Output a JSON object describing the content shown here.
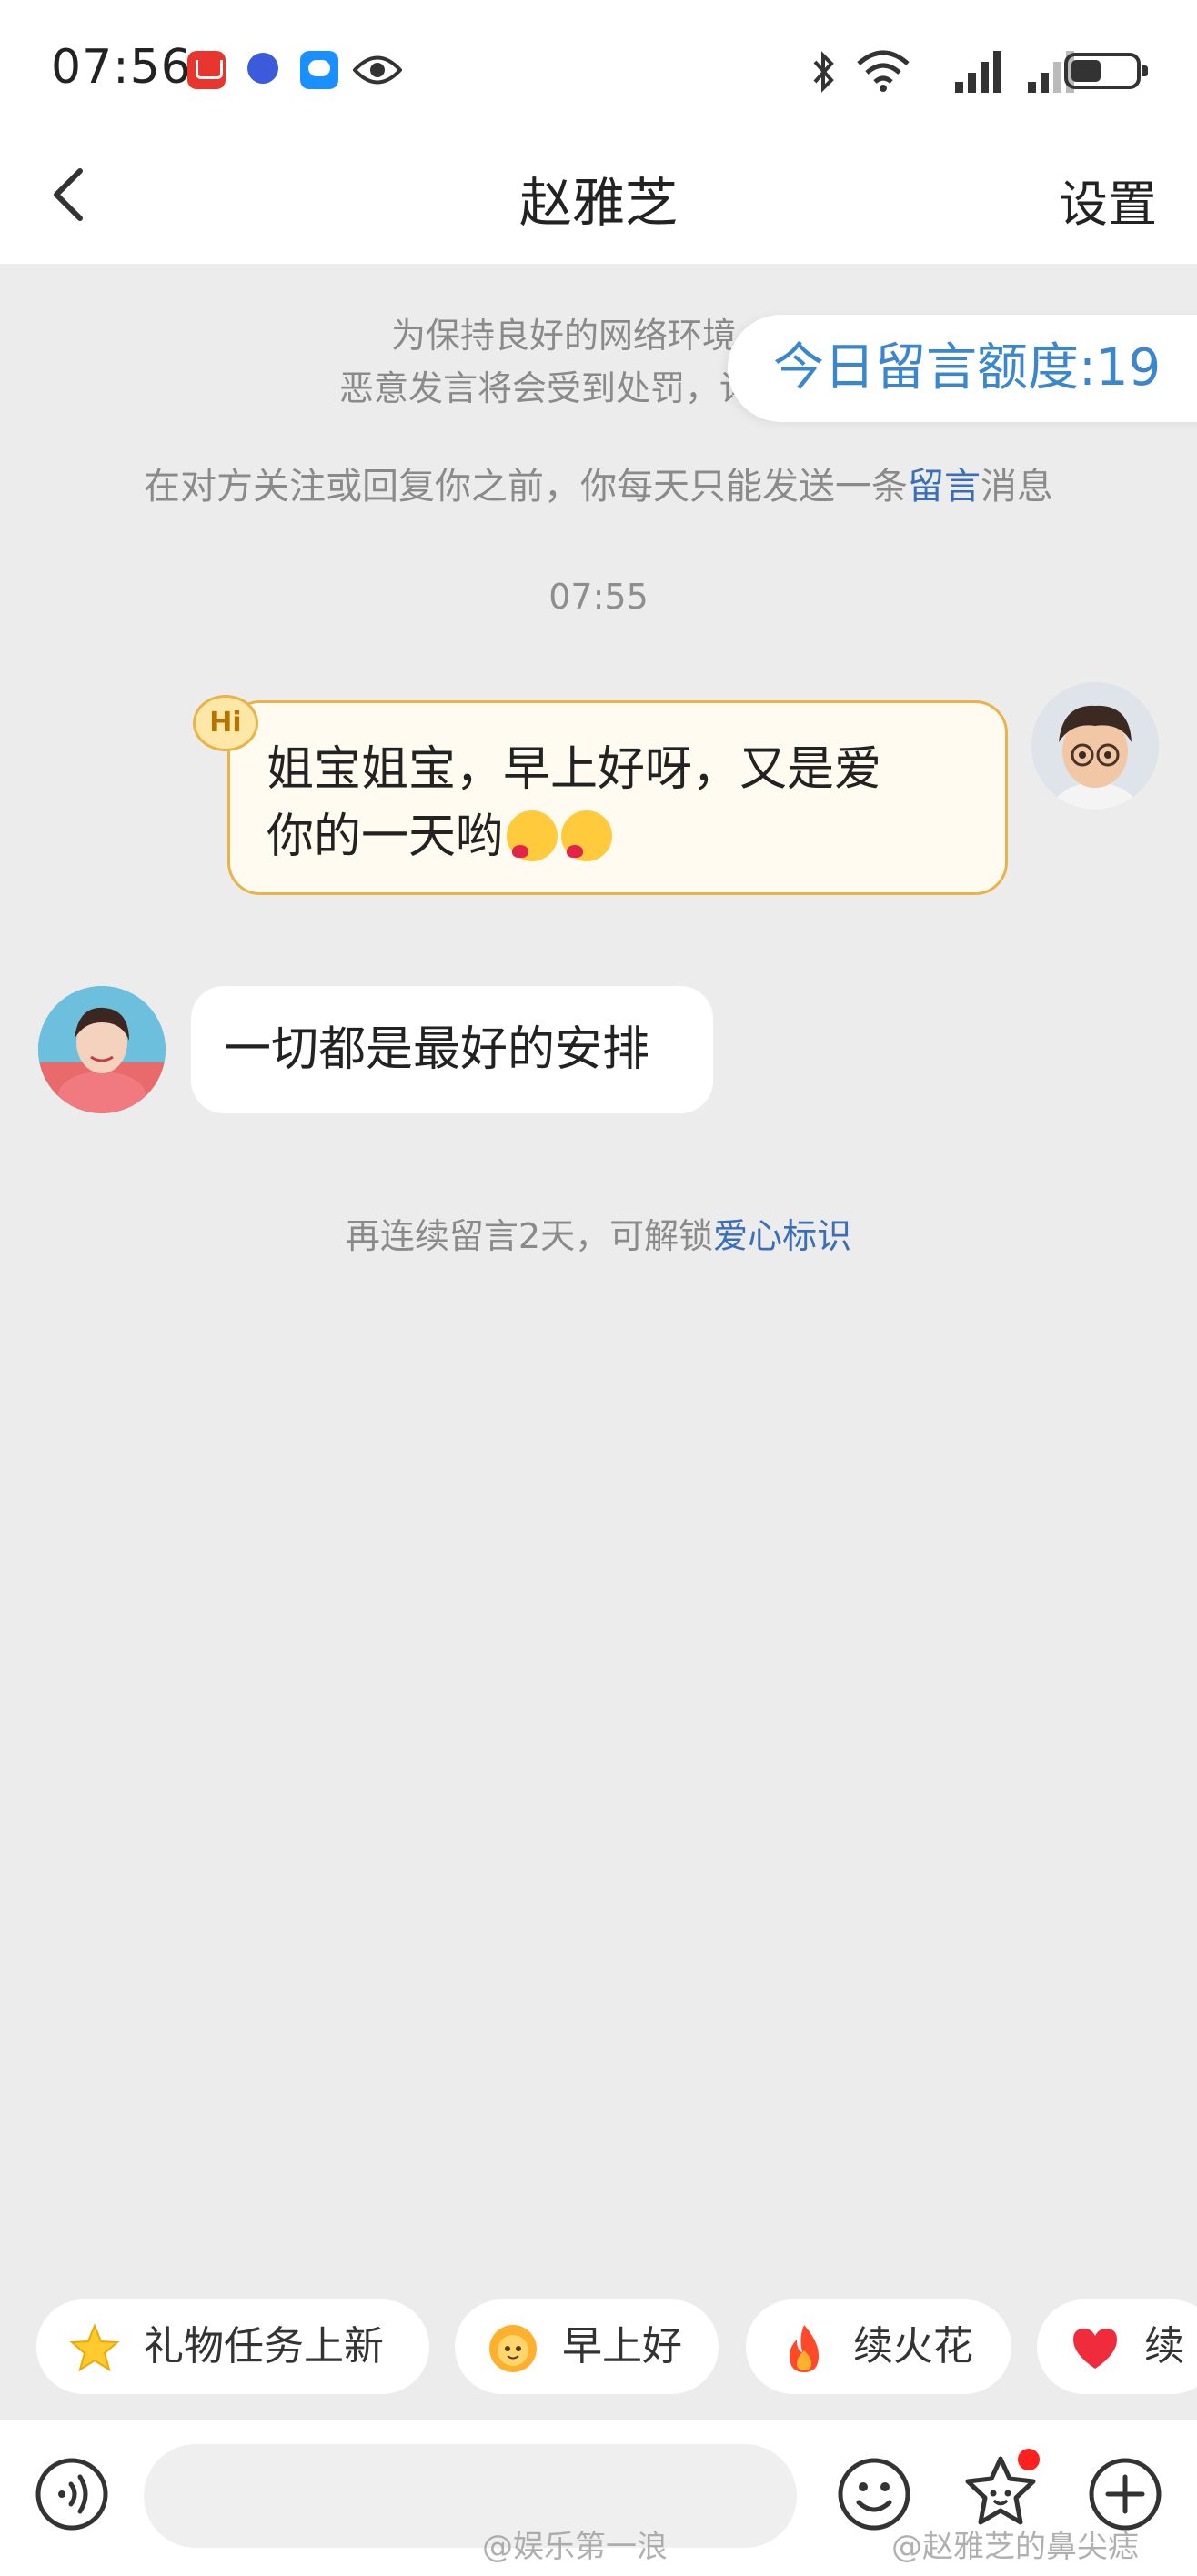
{
  "status_bar": {
    "time": "07:56"
  },
  "nav": {
    "title": "赵雅芝",
    "settings_label": "设置"
  },
  "notice": {
    "line1": "为保持良好的网络环境，请",
    "line2": "恶意发言将会受到处罚，详细细则"
  },
  "quota": {
    "label": "今日留言额度:19"
  },
  "rule": {
    "prefix": "在对方关注或回复你之前，你每天只能发送一条",
    "link": "留言",
    "suffix": "消息"
  },
  "timestamp": "07:55",
  "messages": [
    {
      "side": "right",
      "badge": "Hi",
      "line1": "姐宝姐宝，早上好呀，又是爱",
      "line2": "你的一天哟"
    },
    {
      "side": "left",
      "text": "一切都是最好的安排"
    }
  ],
  "streak": {
    "prefix": "再连续留言2天，可解锁",
    "link": "爱心标识"
  },
  "quick_replies": [
    {
      "label": "礼物任务上新",
      "icon": "star-icon"
    },
    {
      "label": "早上好",
      "icon": "sun-face-icon"
    },
    {
      "label": "续火花",
      "icon": "fire-icon"
    },
    {
      "label": "续",
      "icon": "heart-icon"
    }
  ],
  "input": {
    "placeholder": ""
  },
  "watermarks": {
    "left": "@娱乐第一浪",
    "right": "@赵雅芝的鼻尖痣"
  },
  "colors": {
    "accent_blue": "#3a86cf",
    "bubble_border": "#e8b44a",
    "bubble_fill": "#fffbf0",
    "background": "#ececec"
  }
}
